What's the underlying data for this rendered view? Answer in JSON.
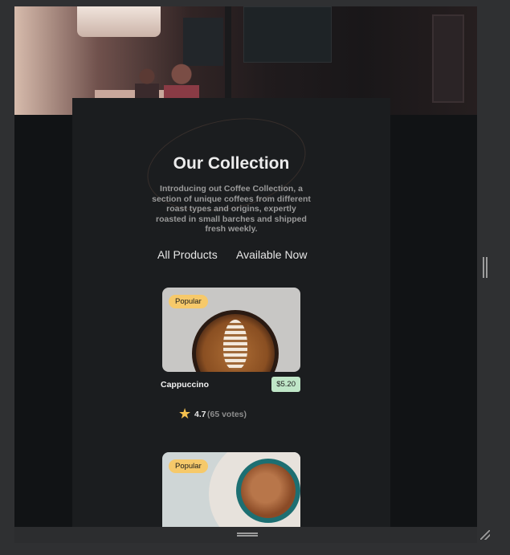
{
  "collection": {
    "title": "Our Collection",
    "description": "Introducing out Coffee Collection, a section of unique coffees from different roast types and origins, expertly roasted in small barches and shipped fresh weekly.",
    "tabs": [
      {
        "label": "All Products"
      },
      {
        "label": "Available Now"
      }
    ]
  },
  "products": [
    {
      "badge": "Popular",
      "name": "Cappuccino",
      "price": "$5.20",
      "rating": "4.7",
      "votes": "(65 votes)",
      "image_icon": "cappuccino-image"
    },
    {
      "badge": "Popular",
      "image_icon": "coffee-cup-image"
    }
  ],
  "icons": {
    "rating": "star-icon",
    "resize": "resize-grip-icon"
  },
  "colors": {
    "badge": "#f6c96a",
    "price_tag": "#bfe6c7",
    "star": "#f4c04e",
    "panel": "#1b1d1f"
  }
}
